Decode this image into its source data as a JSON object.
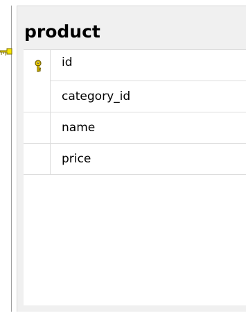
{
  "table": {
    "name": "product",
    "columns": [
      {
        "name": "id",
        "primary_key": true
      },
      {
        "name": "category_id",
        "primary_key": false
      },
      {
        "name": "name",
        "primary_key": false
      },
      {
        "name": "price",
        "primary_key": false
      }
    ]
  },
  "colors": {
    "key_icon": "#e8c000",
    "connector": "#e8d000",
    "panel_bg": "#f0f0f0",
    "row_border": "#dcdcdc"
  },
  "icons": {
    "primary_key": "key-icon",
    "relationship_end": "relationship-key-end-icon"
  }
}
